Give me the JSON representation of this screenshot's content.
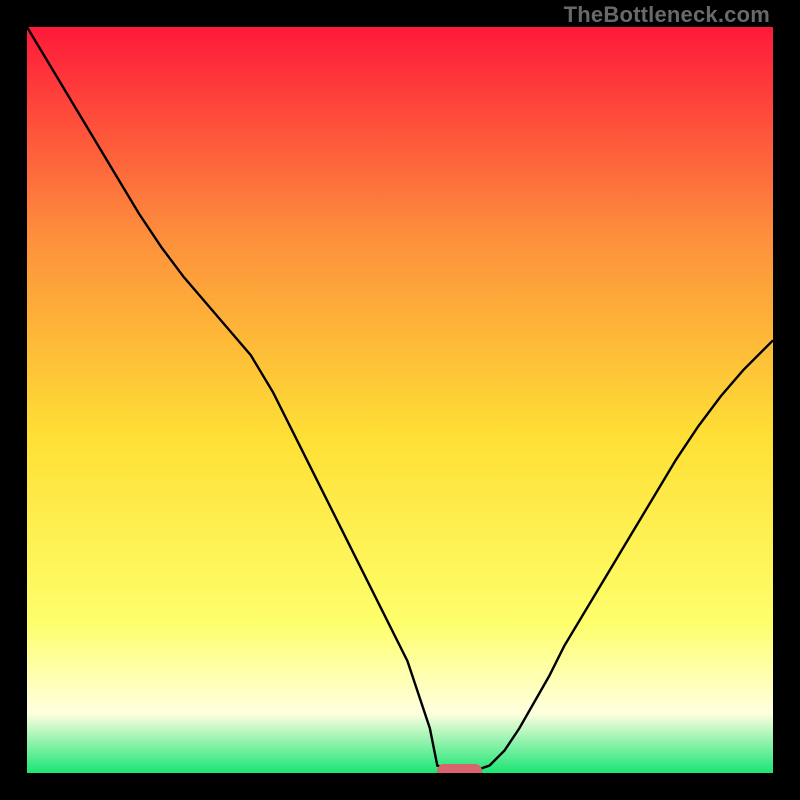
{
  "watermark": "TheBottleneck.com",
  "colors": {
    "gradient_top": "#fe193a",
    "gradient_mid_upper": "#fd8f3c",
    "gradient_mid": "#fee035",
    "gradient_mid_lower": "#feff6c",
    "gradient_near_bottom": "#ffffe0",
    "gradient_bottom": "#1ae574",
    "frame": "#000000",
    "curve": "#000000",
    "marker": "#d9646e"
  },
  "chart_data": {
    "type": "line",
    "title": "",
    "xlabel": "",
    "ylabel": "",
    "xlim": [
      0,
      100
    ],
    "ylim": [
      0,
      100
    ],
    "x": [
      0,
      3,
      6,
      9,
      12,
      15,
      18,
      21,
      24,
      27,
      30,
      33,
      36,
      39,
      42,
      45,
      48,
      51,
      54,
      55,
      57,
      60,
      62,
      64,
      66,
      68,
      70,
      72,
      75,
      78,
      81,
      84,
      87,
      90,
      93,
      96,
      100
    ],
    "values": [
      100,
      95,
      90,
      85,
      80,
      75,
      70.5,
      66.5,
      63,
      59.5,
      56,
      51,
      45,
      39,
      33,
      27,
      21,
      15,
      6,
      1,
      0.3,
      0.3,
      1,
      3,
      6,
      9.5,
      13,
      17,
      22,
      27,
      32,
      37,
      42,
      46.5,
      50.5,
      54,
      58
    ],
    "marker": {
      "x_start": 55,
      "x_end": 61,
      "y": 0
    },
    "grid": false,
    "legend": false
  }
}
